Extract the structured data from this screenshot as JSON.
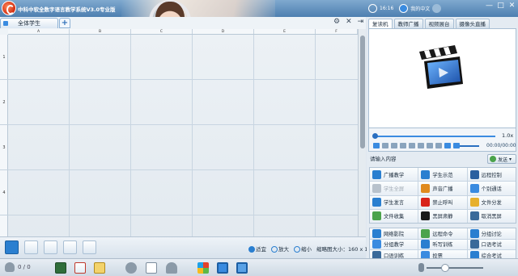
{
  "app": {
    "title": "中科中软全数字语言教学系统V3.0专业版",
    "clock": "16:16",
    "input_method": "我的中文",
    "window_buttons": [
      "settings-icon",
      "close-icon",
      "pin-icon"
    ]
  },
  "grid": {
    "tab_label": "全体学生",
    "add_tab_label": "+",
    "columns": [
      "A",
      "B",
      "C",
      "D",
      "E",
      "F"
    ],
    "rows": [
      "1",
      "2",
      "3",
      "4"
    ]
  },
  "grid_toolbar": {
    "view_buttons": [
      "seat-view-icon",
      "list-view-icon",
      "student-info-icon",
      "screen-view-icon",
      "group-view-icon"
    ],
    "fit_label": "适宜",
    "zoom_in_label": "放大",
    "zoom_out_label": "缩小",
    "thumb_size_label": "缩略图大小：",
    "thumb_size_value": "160 x 120"
  },
  "right_panel": {
    "tabs": [
      "复读机",
      "教师广播",
      "视频展台",
      "摄像头直播"
    ],
    "active_tab": 0,
    "speed": "1.0x",
    "time": "00:00/00:00",
    "progress": 0,
    "input_placeholder": "请输入内容",
    "send_label": "发送",
    "group1": [
      {
        "label": "广播教学",
        "icon": "broadcast-icon",
        "color": "#2a7fd0",
        "enabled": true
      },
      {
        "label": "学生示范",
        "icon": "student-demo-icon",
        "color": "#2a7fd0",
        "enabled": true
      },
      {
        "label": "远程控制",
        "icon": "remote-control-icon",
        "color": "#2a5f9f",
        "enabled": true
      },
      {
        "label": "学生全屏",
        "icon": "fullscreen-icon",
        "color": "#b8c2cc",
        "enabled": false
      },
      {
        "label": "声音广播",
        "icon": "sound-broadcast-icon",
        "color": "#e08a1e",
        "enabled": true
      },
      {
        "label": "个别通话",
        "icon": "private-call-icon",
        "color": "#3a8be0",
        "enabled": true
      },
      {
        "label": "学生发言",
        "icon": "student-speak-icon",
        "color": "#2a7fd0",
        "enabled": true
      },
      {
        "label": "禁止呼叫",
        "icon": "forbid-call-icon",
        "color": "#d8231a",
        "enabled": true
      },
      {
        "label": "文件分发",
        "icon": "file-send-icon",
        "color": "#e7b02c",
        "enabled": true
      },
      {
        "label": "文件收集",
        "icon": "file-collect-icon",
        "color": "#4ba34b",
        "enabled": true
      },
      {
        "label": "黑屏肃静",
        "icon": "black-screen-icon",
        "color": "#1a1a1a",
        "enabled": true
      },
      {
        "label": "取消黑屏",
        "icon": "cancel-black-screen-icon",
        "color": "#3a6a9a",
        "enabled": true
      }
    ],
    "group2": [
      {
        "label": "网络影院",
        "icon": "cinema-icon",
        "color": "#2a7fd0",
        "enabled": true
      },
      {
        "label": "远程命令",
        "icon": "remote-command-icon",
        "color": "#4ba34b",
        "enabled": true
      },
      {
        "label": "分组讨论",
        "icon": "group-discuss-icon",
        "color": "#2a7fd0",
        "enabled": true
      },
      {
        "label": "分组教学",
        "icon": "group-teach-icon",
        "color": "#3a8be0",
        "enabled": true
      },
      {
        "label": "听写训练",
        "icon": "dictation-icon",
        "color": "#2a7fd0",
        "enabled": true
      },
      {
        "label": "口语考试",
        "icon": "oral-exam-icon",
        "color": "#3a6a9a",
        "enabled": true
      },
      {
        "label": "口语训练",
        "icon": "oral-training-icon",
        "color": "#3a6a9a",
        "enabled": true
      },
      {
        "label": "投票",
        "icon": "vote-icon",
        "color": "#3a8be0",
        "enabled": true
      },
      {
        "label": "综合考试",
        "icon": "exam-icon",
        "color": "#2a7fd0",
        "enabled": true
      },
      {
        "label": "辅助功能",
        "icon": "assist-icon",
        "color": "#e08a1e",
        "enabled": true
      },
      {
        "label": "全体复位",
        "icon": "reset-all-icon",
        "color": "#d8231a",
        "enabled": true
      },
      {
        "label": "情景训练",
        "icon": "scenario-training-icon",
        "color": "#2a7fd0",
        "enabled": true
      }
    ]
  },
  "taskbar": {
    "online_count": "0 / 0",
    "icons": [
      "blackboard-icon",
      "whiteboard-icon",
      "roll-call-icon",
      "chat-icon",
      "document-icon",
      "hand-raise-icon",
      "start-icon",
      "computer-icon",
      "screen-icon"
    ],
    "mic_level": 0.33
  }
}
